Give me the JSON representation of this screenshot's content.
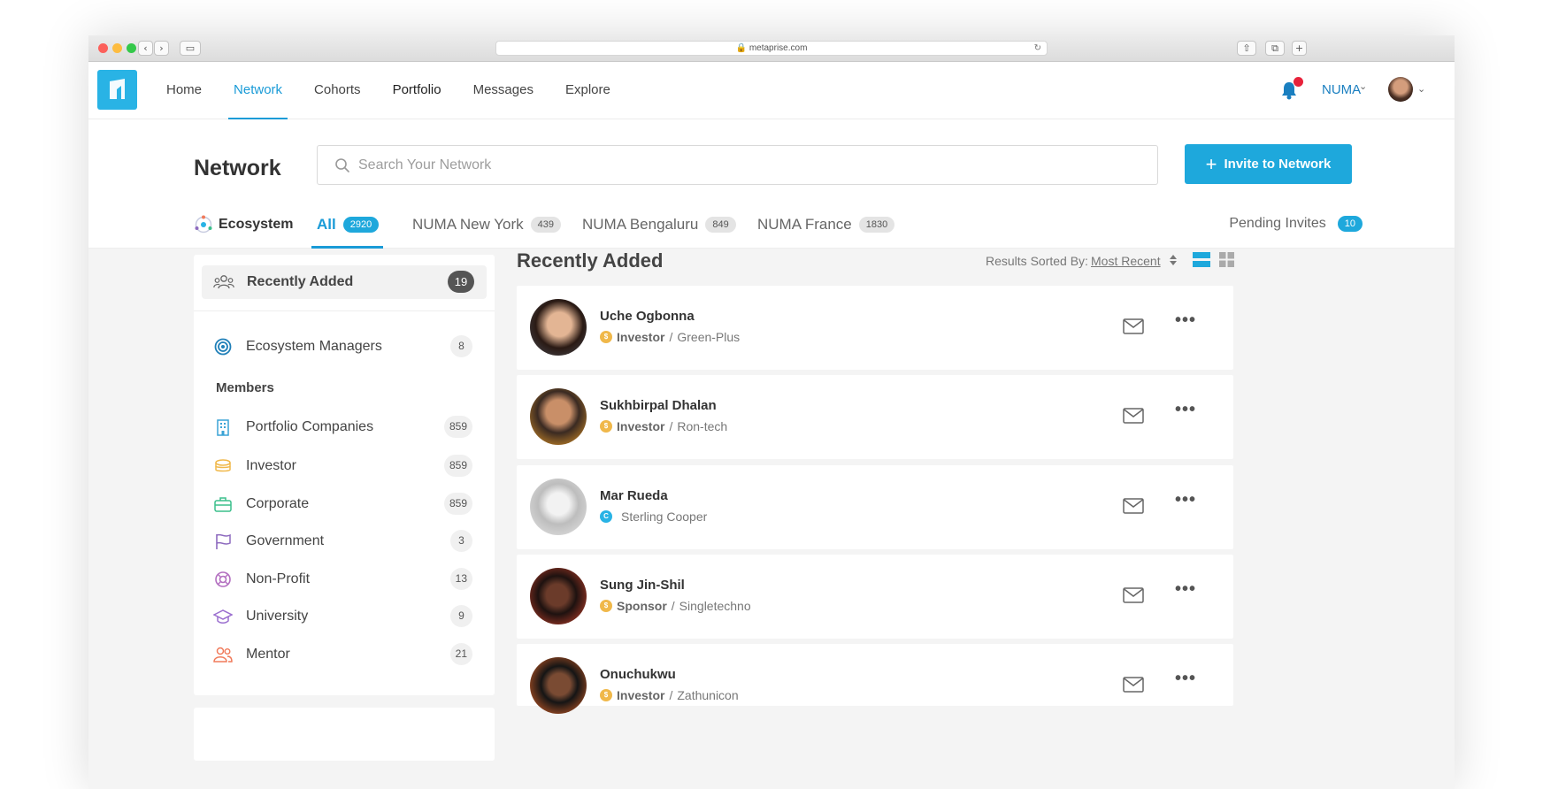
{
  "browser": {
    "url": "metaprise.com",
    "back_icon": "chevron-left-icon",
    "forward_icon": "chevron-right-icon"
  },
  "nav": {
    "links": [
      "Home",
      "Network",
      "Cohorts",
      "Portfolio",
      "Messages",
      "Explore"
    ],
    "active": "Network",
    "org": "NUMA",
    "accent": "#1a9bd7",
    "notification_color": "#e8223b"
  },
  "network": {
    "title": "Network",
    "search_placeholder": "Search Your Network",
    "invite_label": "Invite to Network",
    "ecosystem_label": "Ecosystem",
    "tabs": [
      {
        "label": "All",
        "count": "2920"
      },
      {
        "label": "NUMA New York",
        "count": "439"
      },
      {
        "label": "NUMA Bengaluru",
        "count": "849"
      },
      {
        "label": "NUMA France",
        "count": "1830"
      }
    ],
    "pending_label": "Pending Invites",
    "pending_count": "10"
  },
  "sidebar": {
    "top": {
      "label": "Recently Added",
      "count": "19"
    },
    "managers": {
      "label": "Ecosystem Managers",
      "count": "8"
    },
    "members_heading": "Members",
    "members": [
      {
        "label": "Portfolio Companies",
        "count": "859",
        "icon": "building-icon",
        "color": "#3aa3d6"
      },
      {
        "label": "Investor",
        "count": "859",
        "icon": "coins-icon",
        "color": "#f0b84a"
      },
      {
        "label": "Corporate",
        "count": "859",
        "icon": "briefcase-icon",
        "color": "#3bbf8c"
      },
      {
        "label": "Government",
        "count": "3",
        "icon": "flag-icon",
        "color": "#8e6bbf"
      },
      {
        "label": "Non-Profit",
        "count": "13",
        "icon": "lifebuoy-icon",
        "color": "#b36fc0"
      },
      {
        "label": "University",
        "count": "9",
        "icon": "graduation-cap-icon",
        "color": "#9b6fcf"
      },
      {
        "label": "Mentor",
        "count": "21",
        "icon": "people-icon",
        "color": "#f07a5a"
      }
    ]
  },
  "main": {
    "title": "Recently Added",
    "sort_label": "Results Sorted By:",
    "sort_value": "Most Recent",
    "people": [
      {
        "name": "Uche Ogbonna",
        "role": "Investor",
        "sep": " / ",
        "org": "Green-Plus",
        "badge": "$",
        "badge_color": "#f0b84a"
      },
      {
        "name": "Sukhbirpal Dhalan",
        "role": "Investor",
        "sep": " / ",
        "org": "Ron-tech",
        "badge": "$",
        "badge_color": "#f0b84a"
      },
      {
        "name": "Mar Rueda",
        "role": "",
        "sep": "",
        "org": "Sterling Cooper",
        "badge": "C",
        "badge_color": "#29b3e5"
      },
      {
        "name": "Sung Jin-Shil",
        "role": "Sponsor",
        "sep": " / ",
        "org": "Singletechno",
        "badge": "$",
        "badge_color": "#f0b84a"
      },
      {
        "name": "Onuchukwu",
        "role": "Investor",
        "sep": " / ",
        "org": "Zathunicon",
        "badge": "$",
        "badge_color": "#f0b84a"
      }
    ]
  }
}
